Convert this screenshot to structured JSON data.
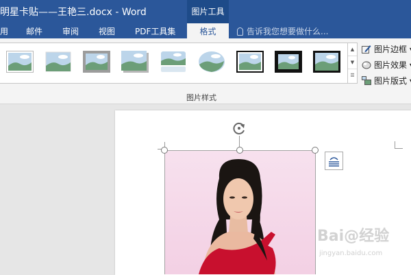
{
  "window": {
    "title": "明星卡贴——王艳三.docx - Word",
    "contextual_tab_group": "图片工具"
  },
  "tabs": {
    "items": [
      "用",
      "邮件",
      "审阅",
      "视图",
      "PDF工具集",
      "格式"
    ],
    "active": "格式",
    "tell_me_placeholder": "告诉我您想要做什么..."
  },
  "ribbon": {
    "gallery_styles": [
      "simple-frame-white",
      "soft-edge-rectangle",
      "metal-frame-gray",
      "drop-shadow-rectangle",
      "reflected-rounded",
      "soft-edge-oval",
      "double-frame-black",
      "thick-matte-black",
      "simple-frame-black"
    ],
    "commands": [
      "图片边框 ▾",
      "图片效果 ▾",
      "图片版式 ▾"
    ],
    "group_label": "图片样式"
  },
  "document": {
    "image_description_label": "",
    "watermark": "Bai@经验",
    "watermark_sub": "jingyan.baidu.com"
  },
  "colors": {
    "titlebar": "#2b579a",
    "ribbon_bg": "#f4f4f4",
    "photo_bg": "#f6dded",
    "dress": "#c8102e"
  }
}
